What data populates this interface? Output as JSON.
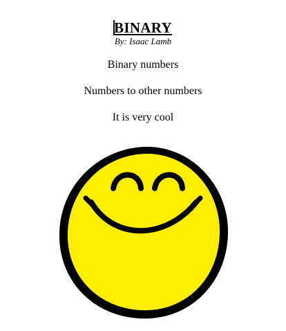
{
  "document": {
    "title": "BINARY",
    "byline": "By: Isaac Lamb",
    "lines": [
      "Binary numbers",
      "Numbers to other numbers",
      "It is very cool"
    ]
  },
  "image": {
    "icon": "smiley-face-icon",
    "face_color": "#ffee00",
    "outline_color": "#000000"
  }
}
